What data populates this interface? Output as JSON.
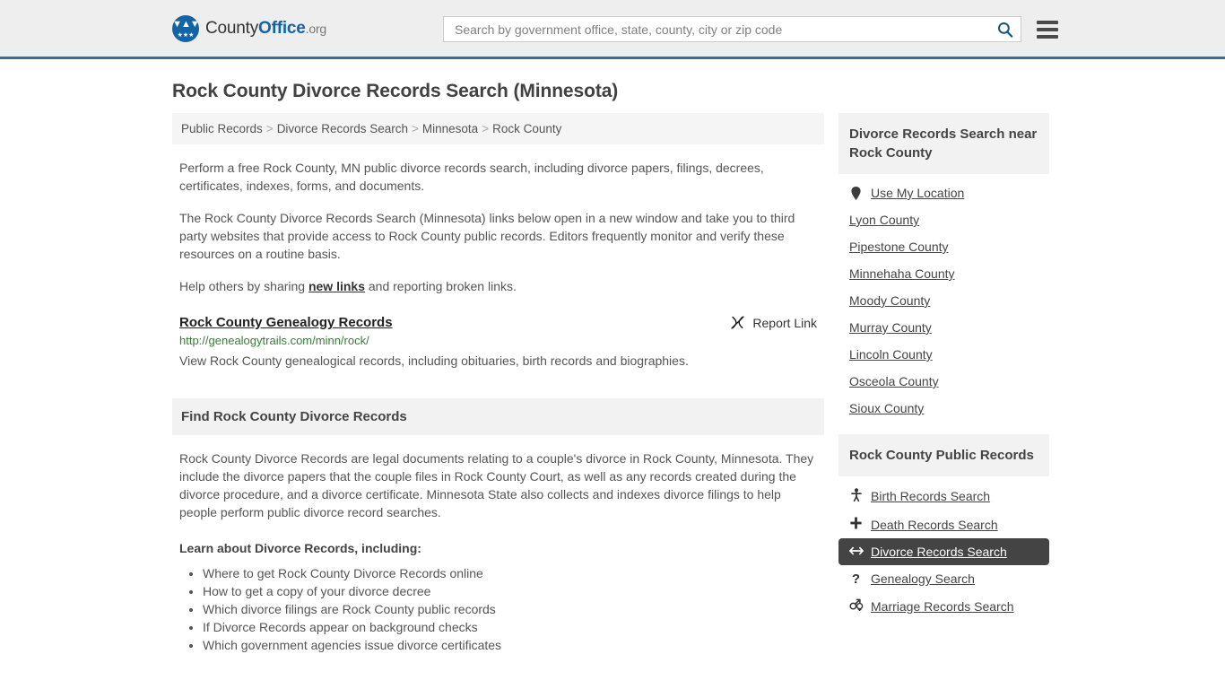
{
  "header": {
    "logo": {
      "name_part1": "County",
      "name_part2": "Office",
      "name_part3": ".org",
      "mark_alt": "eagle-shield-logo"
    },
    "search": {
      "placeholder": "Search by government office, state, county, city or zip code",
      "value": "",
      "search_icon": "search-icon"
    },
    "menu_icon": "hamburger-menu-icon",
    "accent_color": "#337199"
  },
  "page_title": "Rock County Divorce Records Search (Minnesota)",
  "breadcrumb": {
    "items": [
      {
        "label": "Public Records"
      },
      {
        "label": "Divorce Records Search"
      },
      {
        "label": "Minnesota"
      },
      {
        "label": "Rock County"
      }
    ],
    "separator": ">"
  },
  "intro": {
    "p1": "Perform a free Rock County, MN public divorce records search, including divorce papers, filings, decrees, certificates, indexes, forms, and documents.",
    "p2": "The Rock County Divorce Records Search (Minnesota) links below open in a new window and take you to third party websites that provide access to Rock County public records. Editors frequently monitor and verify these resources on a routine basis.",
    "p3_before": "Help others by sharing ",
    "p3_link": "new links",
    "p3_after": " and reporting broken links."
  },
  "result": {
    "title": "Rock County Genealogy Records",
    "report_label": "Report Link",
    "report_icon": "broken-link-icon",
    "url": "http://genealogytrails.com/minn/rock/",
    "url_color": "#3a7a3a",
    "description": "View Rock County genealogical records, including obituaries, birth records and biographies."
  },
  "find_section": {
    "heading": "Find Rock County Divorce Records",
    "paragraph": "Rock County Divorce Records are legal documents relating to a couple's divorce in Rock County, Minnesota. They include the divorce papers that the couple files in Rock County Court, as well as any records created during the divorce procedure, and a divorce certificate. Minnesota State also collects and indexes divorce filings to help people perform public divorce record searches.",
    "lead_in": "Learn about Divorce Records, including:",
    "bullets": [
      "Where to get Rock County Divorce Records online",
      "How to get a copy of your divorce decree",
      "Which divorce filings are Rock County public records",
      "If Divorce Records appear on background checks",
      "Which government agencies issue divorce certificates"
    ]
  },
  "sidebar": {
    "nearby": {
      "heading": "Divorce Records Search near Rock County",
      "items": [
        {
          "label": "Use My Location",
          "icon": "map-pin-icon"
        },
        {
          "label": "Lyon County",
          "icon": ""
        },
        {
          "label": "Pipestone County",
          "icon": ""
        },
        {
          "label": "Minnehaha County",
          "icon": ""
        },
        {
          "label": "Moody County",
          "icon": ""
        },
        {
          "label": "Murray County",
          "icon": ""
        },
        {
          "label": "Lincoln County",
          "icon": ""
        },
        {
          "label": "Osceola County",
          "icon": ""
        },
        {
          "label": "Sioux County",
          "icon": ""
        }
      ]
    },
    "public_records": {
      "heading": "Rock County Public Records",
      "active_background": "#444444",
      "items": [
        {
          "label": "Birth Records Search",
          "icon": "baby-icon",
          "glyph": "\u0001",
          "active": false
        },
        {
          "label": "Death Records Search",
          "icon": "cross-icon",
          "glyph": "✚",
          "active": false
        },
        {
          "label": "Divorce Records Search",
          "icon": "left-right-arrow-icon",
          "glyph": "↔",
          "active": true
        },
        {
          "label": "Genealogy Search",
          "icon": "question-mark-icon",
          "glyph": "?",
          "active": false
        },
        {
          "label": "Marriage Records Search",
          "icon": "male-female-icon",
          "glyph": "⚥",
          "active": false
        }
      ]
    }
  }
}
